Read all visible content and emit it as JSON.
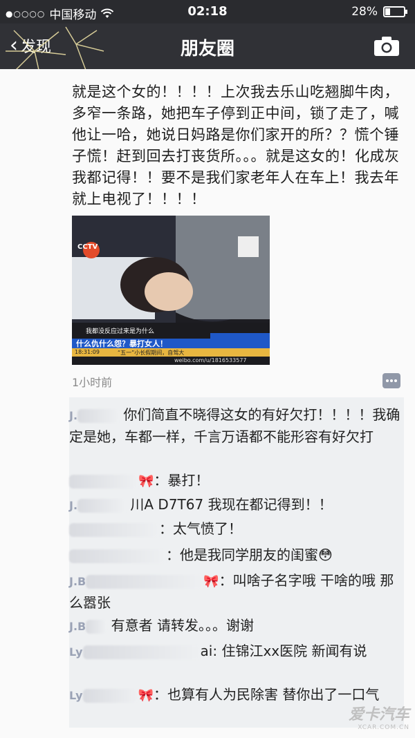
{
  "status": {
    "signal_dots": "●○○○○",
    "carrier": "中国移动",
    "time": "02:18",
    "battery": "28%",
    "battery_level": 0.28
  },
  "navbar": {
    "back_label": "发现",
    "title": "朋友圈",
    "camera_icon": "camera-icon"
  },
  "post": {
    "text": "就是这个女的！！！！上次我去乐山吃翘脚牛肉，多窄一条路，她把车子停到正中间，锁了走了，喊他让一哈，她说日妈路是你们家开的所？？慌个锤子慌！赶到回去打丧货所。。。就是这女的！化成灰我都记得！！要不是我们家老年人在车上！我去年就上电视了！！！！",
    "photo": {
      "channel": "CCTV",
      "ticker_top": "我都没反应过来是为什么",
      "headline": "什么仇什么怨？暴打女人！",
      "clock": "18:31:09",
      "bottom_strip": "“五一”小长假期间，自驾大",
      "credit": "weibo.com/u/1816533577"
    },
    "time_ago": "1小时前"
  },
  "comments": [
    {
      "name": "J.",
      "text": "你们简直不晓得这女的有好欠打！！！！我确定是她，车都一样，千言万语都不能形容有好欠打"
    },
    {
      "name": "",
      "text": "：暴打！"
    },
    {
      "name": "J.",
      "text": "川A D7T67 我现在都记得到！！"
    },
    {
      "name": "",
      "text": "：太气愤了！"
    },
    {
      "name": "",
      "text": "：他是我同学朋友的闺蜜😳"
    },
    {
      "name": "J.B",
      "text": "：叫啥子名字哦 干啥的哦 那么嚣张"
    },
    {
      "name": "J.B",
      "text": "有意者 请转发。。。谢谢"
    },
    {
      "name": "Ly",
      "text": "ai: 住锦江xx医院 新闻有说"
    },
    {
      "name": "Ly",
      "text": "：也算有人为民除害 替你出了一口气"
    }
  ],
  "watermark": {
    "line1": "爱卡汽车",
    "line2": "XCAR.COM.CN"
  },
  "colors": {
    "statusbar": "#2a2b2f",
    "navbar": "#303136",
    "comment_bg": "#eef0f2",
    "name_color": "#9aa2b5",
    "headline_bg": "#1f58c7"
  }
}
